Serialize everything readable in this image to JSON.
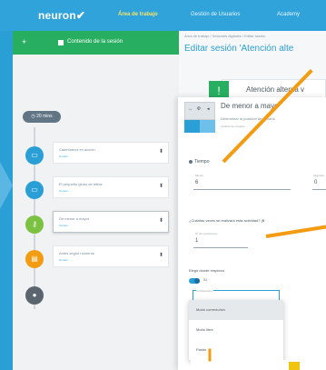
{
  "app": {
    "logo": "neuron"
  },
  "nav": [
    {
      "label": "Área de trabajo",
      "active": true
    },
    {
      "label": "Gestión de Usuarios",
      "active": false
    },
    {
      "label": "Academy",
      "active": false
    }
  ],
  "sidebar": {
    "plus": "+",
    "session_content_label": "Contenido de la sesión"
  },
  "header": {
    "breadcrumb": "Área de trabajo / Sesiones digitales / Editar sesión",
    "title": "Editar sesión 'Atención alte"
  },
  "session": {
    "duration": "20 mins",
    "items": [
      {
        "name": "Calentamos en acción",
        "tag": "Común",
        "color": "#2a9fd6",
        "icon": "chat-icon"
      },
      {
        "name": "El pequeño globo de letras",
        "tag": "Común",
        "color": "#2a9fd6",
        "icon": "chat-icon"
      },
      {
        "name": "De menor a mayor",
        "tag": "Común",
        "color": "#7cc242",
        "icon": "key-icon"
      },
      {
        "name": "Antes según números",
        "tag": "Común",
        "color": "#f39c12",
        "icon": "calendar-icon"
      },
      {
        "name": "",
        "tag": "",
        "color": "#5a6570",
        "icon": "circle-icon"
      }
    ]
  },
  "main_card": {
    "title": "Atención alterna v"
  },
  "activity": {
    "thumb_icons": [
      "↔",
      "Ф",
      "◂"
    ],
    "title": "De menor a mayo",
    "description": "Determinar la posición de tamaño",
    "author": "Instituto de Cuidado",
    "tiempo_label": "Tiempo",
    "minutes_label": "Minuto",
    "minutes_value": "6",
    "seconds_label": "Segundo",
    "seconds_value": "0",
    "repeat_question": "¿Cuántas veces se realizará esta actividad? ($",
    "repeat_field_label": "Nº de repeticiones",
    "repeat_value": "1",
    "elegir_label": "Elegir donde empieza",
    "toggle_label": "Sí",
    "config_label": "Configuración",
    "options": [
      "Modo correcto/sin",
      "Modo libre",
      "Pasito"
    ]
  },
  "colors": {
    "brand_blue": "#2a9fd6",
    "green": "#27ae60",
    "orange": "#f39c12"
  }
}
